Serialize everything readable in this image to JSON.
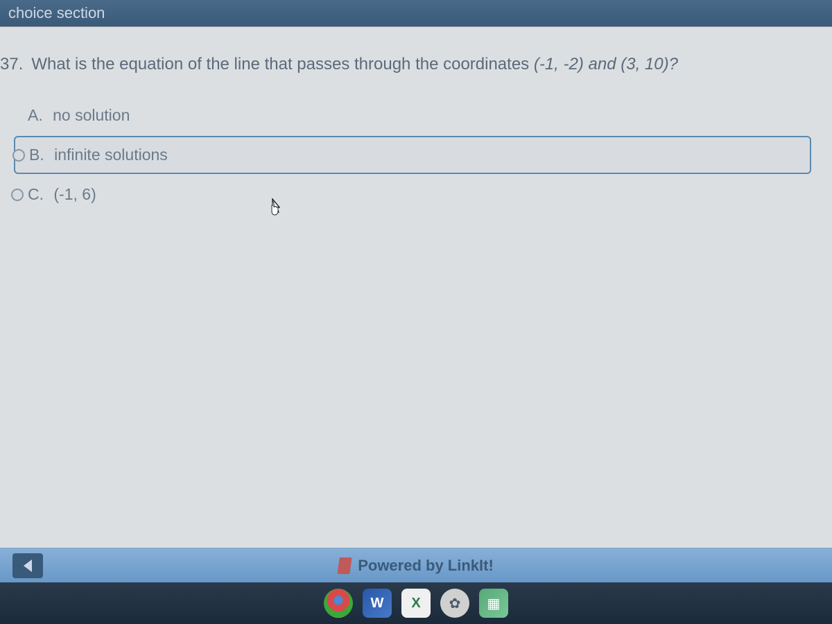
{
  "header": {
    "title": "choice section"
  },
  "question": {
    "number": "37.",
    "text_part1": "What is the equation of the line that passes through the coordinates ",
    "coords1": "(-1, -2)",
    "text_mid": " and ",
    "coords2": "(3, 10)",
    "text_end": "?"
  },
  "choices": [
    {
      "letter": "A.",
      "text": "no solution",
      "selected": false,
      "marker": false
    },
    {
      "letter": "B.",
      "text": "infinite solutions",
      "selected": true,
      "marker": true
    },
    {
      "letter": "C.",
      "text": "(-1, 6)",
      "selected": false,
      "marker": true
    }
  ],
  "footer": {
    "powered_text": "Powered by LinkIt!"
  },
  "taskbar": {
    "icons": [
      "chrome",
      "word",
      "excel",
      "settings",
      "files"
    ]
  }
}
